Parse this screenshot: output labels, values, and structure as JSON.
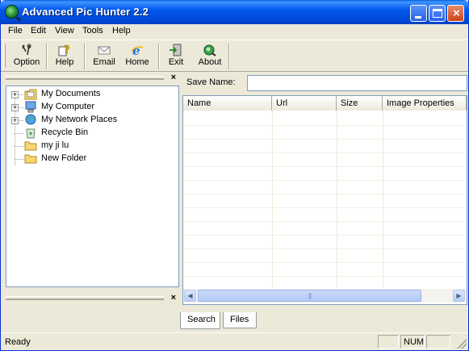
{
  "window": {
    "title": "Advanced Pic Hunter 2.2"
  },
  "menu": [
    "File",
    "Edit",
    "View",
    "Tools",
    "Help"
  ],
  "toolbar": [
    {
      "label": "Option",
      "icon": "tools-icon"
    },
    {
      "label": "Help",
      "icon": "help-icon"
    },
    {
      "label": "Email",
      "icon": "email-icon"
    },
    {
      "label": "Home",
      "icon": "ie-icon"
    },
    {
      "label": "Exit",
      "icon": "exit-icon"
    },
    {
      "label": "About",
      "icon": "about-icon"
    }
  ],
  "tree": [
    {
      "label": "My Documents",
      "expandable": true
    },
    {
      "label": "My Computer",
      "expandable": true
    },
    {
      "label": "My Network Places",
      "expandable": true
    },
    {
      "label": "Recycle Bin",
      "expandable": false
    },
    {
      "label": "my ji lu",
      "expandable": false
    },
    {
      "label": "New Folder",
      "expandable": false
    }
  ],
  "save": {
    "label": "Save Name:",
    "value": ""
  },
  "list": {
    "columns": [
      "Name",
      "Url",
      "Size",
      "Image Properties"
    ],
    "rows": []
  },
  "tabs": [
    "Search",
    "Files"
  ],
  "status": {
    "text": "Ready",
    "num": "NUM"
  },
  "pane_close": "×",
  "colors": {
    "titlebar": "#0058ee",
    "face": "#ece9d8"
  }
}
